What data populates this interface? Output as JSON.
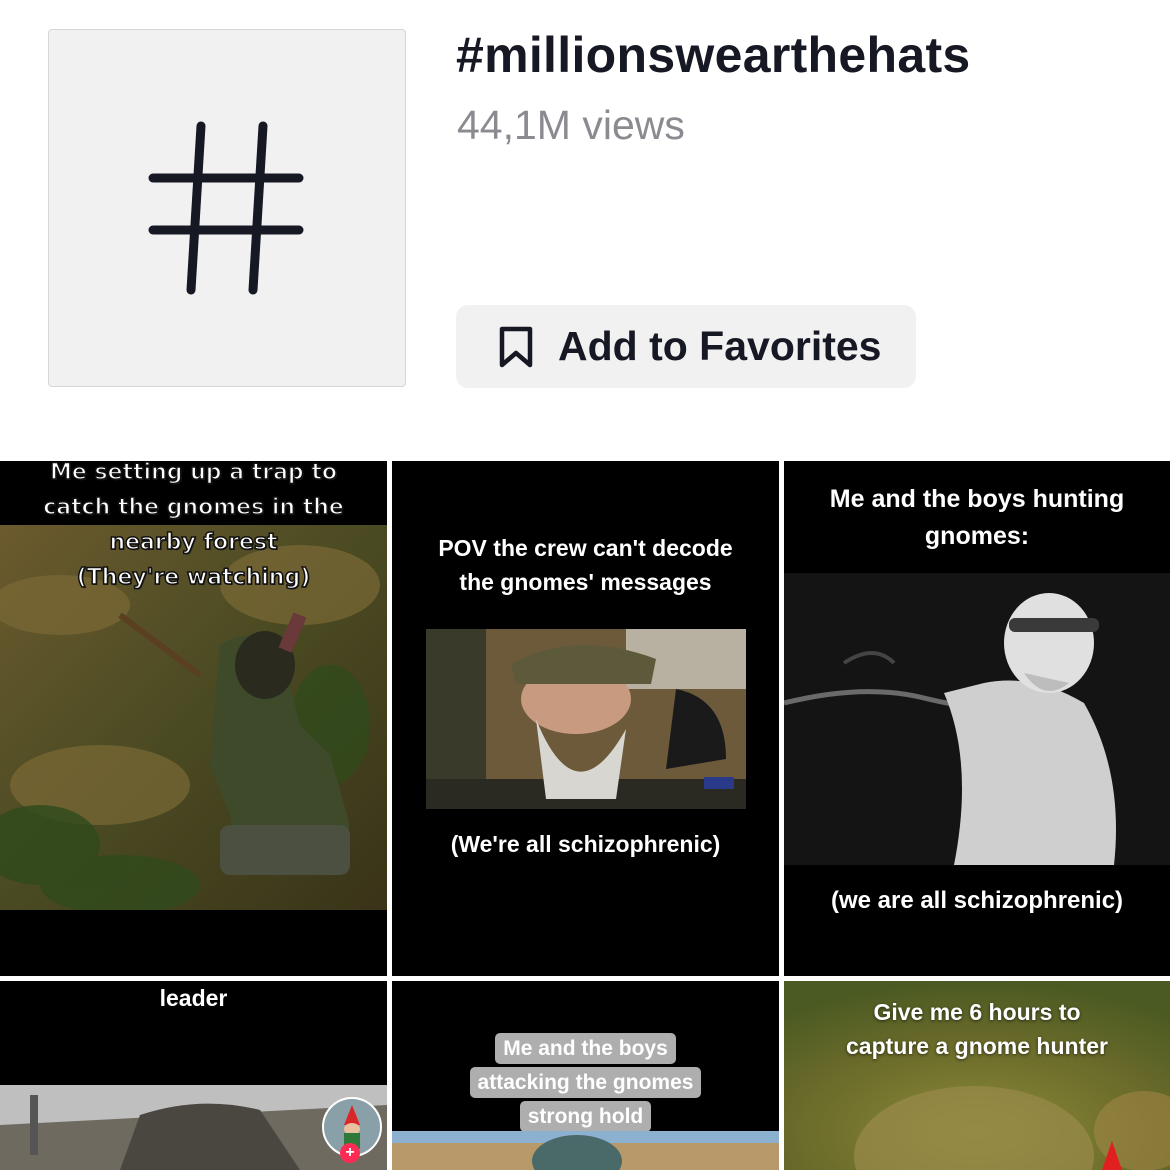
{
  "header": {
    "hashtag_symbol": "#",
    "title": "#millionswearthehats",
    "views": "44,1M views",
    "favorite_label": "Add to Favorites"
  },
  "icons": {
    "hashtag": "hashtag-icon",
    "favorite": "bookmark-icon",
    "follow": "plus-icon"
  },
  "videos": [
    {
      "caption_lines": [
        "Me setting up a trap to",
        "catch the gnomes in the",
        "nearby forest",
        "(They're watching)"
      ]
    },
    {
      "caption_top": [
        "POV the crew can't decode",
        "the gnomes' messages"
      ],
      "caption_bottom": "(We're all schizophrenic)"
    },
    {
      "caption_top": [
        "Me and the boys hunting",
        "gnomes:"
      ],
      "caption_bottom": "(we are all schizophrenic)"
    },
    {
      "caption_top": [
        "leader"
      ]
    },
    {
      "caption_lines": [
        "Me and the boys",
        "attacking the gnomes",
        "strong hold"
      ]
    },
    {
      "caption_top": [
        "Give me 6 hours to",
        "capture a gnome hunter"
      ]
    }
  ],
  "colors": {
    "text_primary": "#161823",
    "text_secondary": "#8a8b91",
    "tile_bg": "#f1f1f2",
    "follow_badge": "#fe2c55"
  }
}
